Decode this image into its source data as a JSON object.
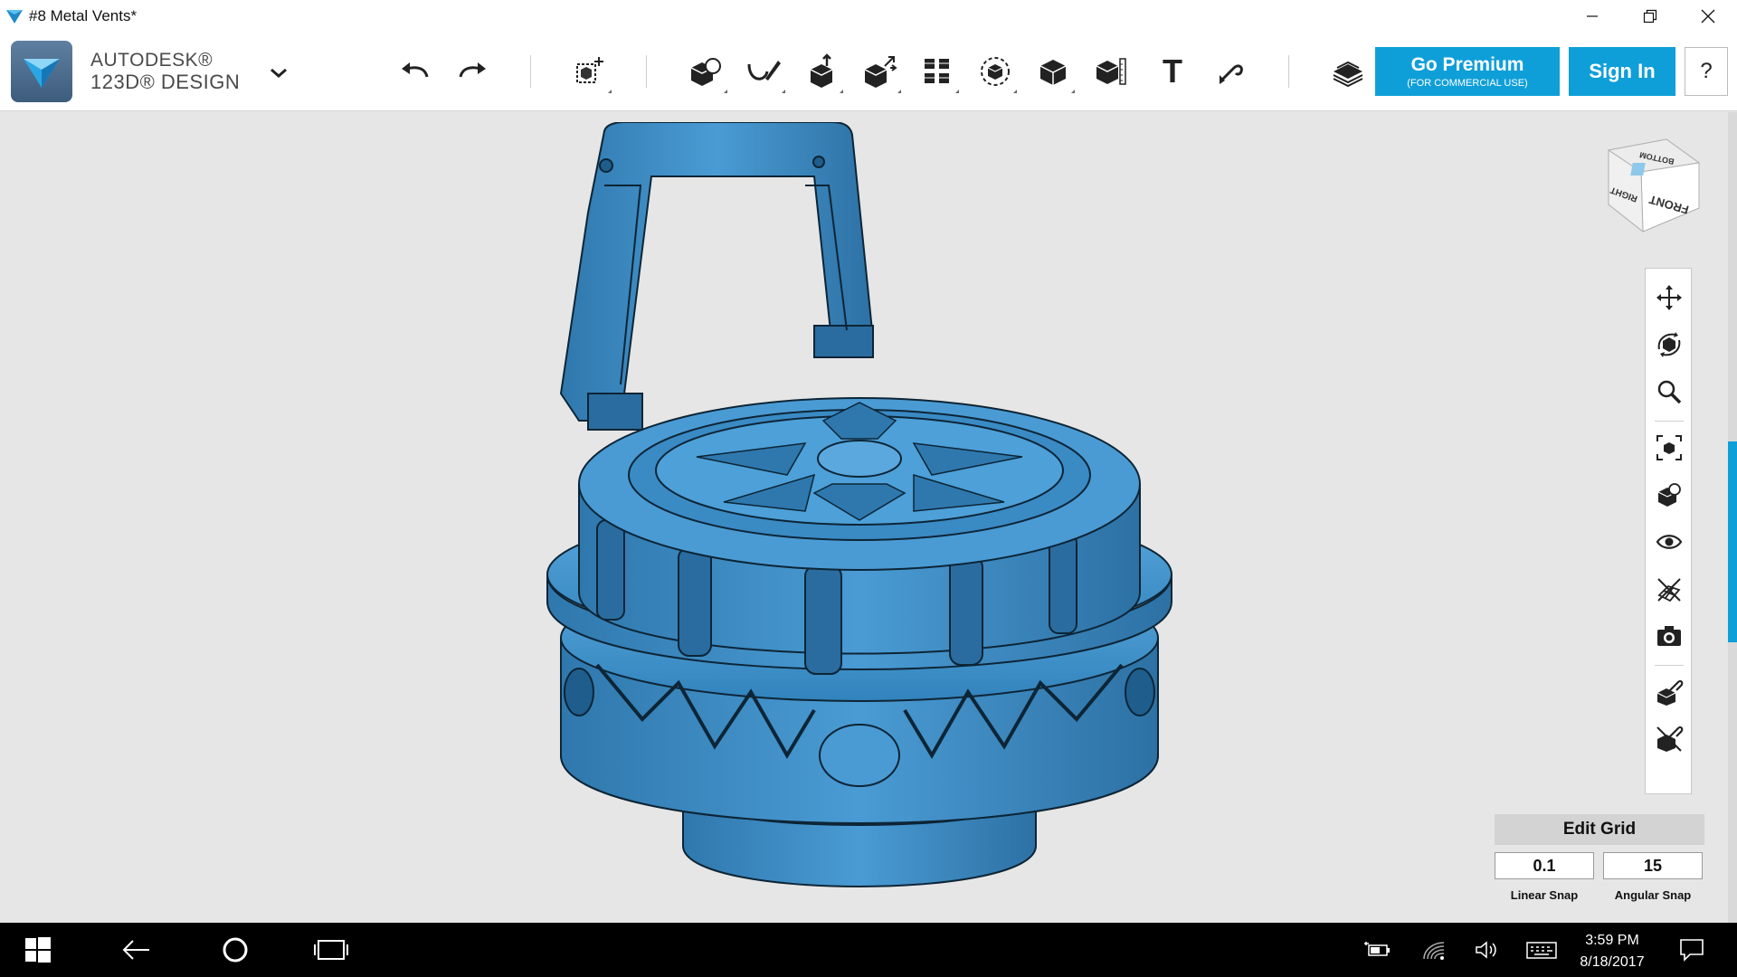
{
  "window": {
    "title": "#8 Metal Vents*"
  },
  "brand": {
    "line1": "AUTODESK®",
    "line2": "123D® DESIGN"
  },
  "toolbar": {
    "tools": [
      {
        "name": "undo",
        "icon": "undo-icon"
      },
      {
        "name": "redo",
        "icon": "redo-icon"
      },
      {
        "name": "transform",
        "icon": "transform-icon"
      },
      {
        "name": "primitives",
        "icon": "primitives-icon"
      },
      {
        "name": "sketch",
        "icon": "sketch-icon"
      },
      {
        "name": "construct",
        "icon": "construct-icon"
      },
      {
        "name": "modify",
        "icon": "modify-icon"
      },
      {
        "name": "pattern",
        "icon": "pattern-icon"
      },
      {
        "name": "group",
        "icon": "group-icon"
      },
      {
        "name": "combine",
        "icon": "combine-icon"
      },
      {
        "name": "measure",
        "icon": "measure-icon"
      },
      {
        "name": "text",
        "icon": "text-icon",
        "glyph": "T"
      },
      {
        "name": "snap",
        "icon": "snap-icon"
      },
      {
        "name": "materials",
        "icon": "layers-icon"
      }
    ],
    "premium_label": "Go Premium",
    "premium_sub": "(FOR COMMERCIAL USE)",
    "signin_label": "Sign In",
    "help_label": "?"
  },
  "viewcube": {
    "faces": [
      "FRONT",
      "RIGHT",
      "BOTTOM"
    ]
  },
  "nav": {
    "items": [
      "pan-icon",
      "orbit-icon",
      "zoom-icon",
      "fit-icon",
      "view-mode-icon",
      "visibility-icon",
      "grid-toggle-icon",
      "screenshot-icon",
      "snap-icon",
      "material-icon"
    ]
  },
  "grid": {
    "edit_label": "Edit Grid",
    "linear_value": "0.1",
    "angular_value": "15",
    "linear_label": "Linear Snap",
    "angular_label": "Angular Snap"
  },
  "taskbar": {
    "time": "3:59 PM",
    "date": "8/18/2017"
  },
  "colors": {
    "accent": "#0f9fd8",
    "model": "#3d8bc4"
  }
}
